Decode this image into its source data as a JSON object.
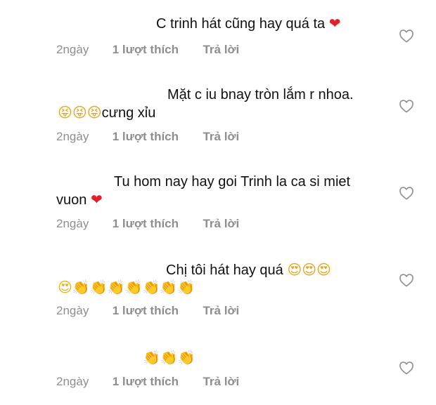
{
  "comments": [
    {
      "line1": "C trinh hát cũng hay quá ta",
      "line1_emoji": "❤",
      "line2": "",
      "line2_emoji": "",
      "time": "2ngày",
      "likes": "1 lượt thích",
      "reply": "Trả lời"
    },
    {
      "line1": "Mặt c iu bnay tròn lắm r nhoa.",
      "line1_emoji": "",
      "line2": "cưng xỉu",
      "line2_emoji": "😝😝😝",
      "time": "2ngày",
      "likes": "1 lượt thích",
      "reply": "Trả lời"
    },
    {
      "line1": "Tu hom nay hay goi Trinh la ca si miet",
      "line1_emoji": "",
      "line2": "vuon",
      "line2_emoji": "❤",
      "time": "2ngày",
      "likes": "1 lượt thích",
      "reply": "Trả lời"
    },
    {
      "line1": "Chị tôi hát hay quá",
      "line1_emoji": "😍😍😍",
      "line2": "",
      "line2_emoji": "😍👏👏👏👏👏👏👏",
      "time": "2ngày",
      "likes": "1 lượt thích",
      "reply": "Trả lời"
    },
    {
      "line1": "",
      "line1_emoji": "👏👏👏",
      "line2": "",
      "line2_emoji": "",
      "time": "2ngày",
      "likes": "1 lượt thích",
      "reply": "Trả lời"
    }
  ]
}
